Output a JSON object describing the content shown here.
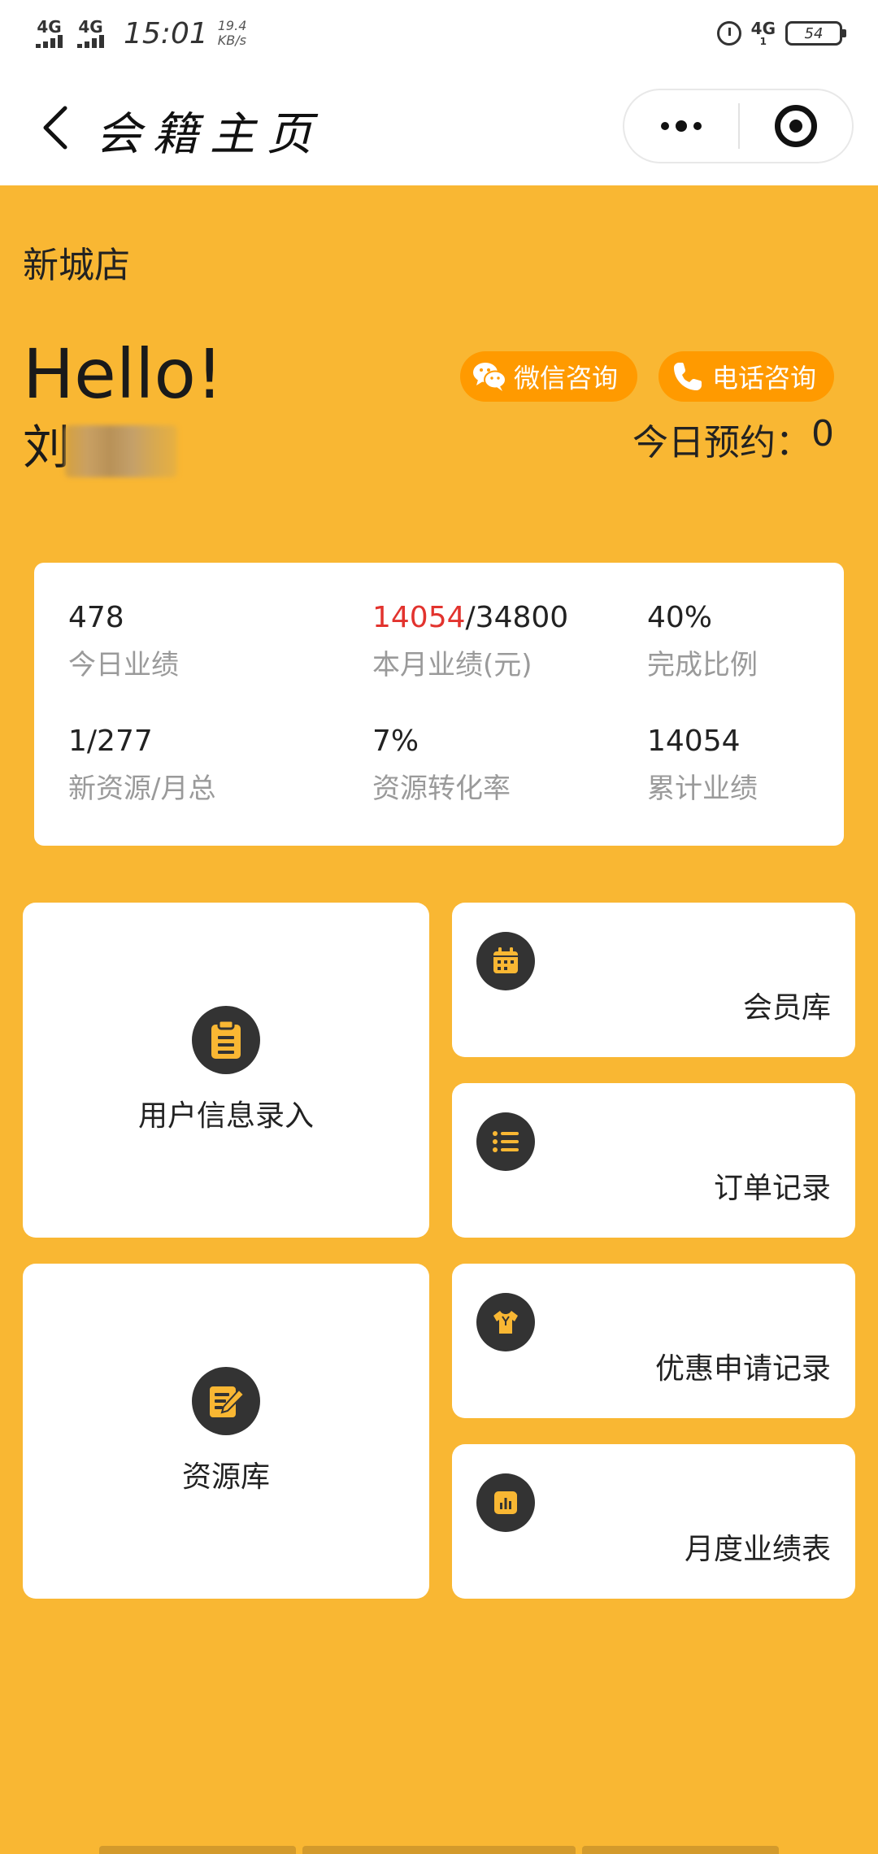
{
  "status_bar": {
    "signal_1": "4G",
    "signal_2": "4G",
    "time": "15:01",
    "speed_value": "19.4",
    "speed_unit": "KB/s",
    "network_right": "4G",
    "network_right_sub": "1",
    "battery": "54"
  },
  "nav": {
    "title": "会籍主页"
  },
  "header": {
    "store_name": "新城店",
    "greeting": "Hello!",
    "user_name": "刘",
    "wechat_button": "微信咨询",
    "phone_button": "电话咨询",
    "today_booking_label": "今日预约：",
    "today_booking_value": "0"
  },
  "stats": {
    "today_performance": {
      "value": "478",
      "label": "今日业绩"
    },
    "month_performance": {
      "value_current": "14054",
      "value_separator": "/",
      "value_target": "34800",
      "label": "本月业绩(元)"
    },
    "completion_ratio": {
      "value": "40%",
      "label": "完成比例"
    },
    "new_resources": {
      "value": "1/277",
      "label": "新资源/月总"
    },
    "conversion_rate": {
      "value": "7%",
      "label": "资源转化率"
    },
    "cumulative_performance": {
      "value": "14054",
      "label": "累计业绩"
    }
  },
  "tiles": {
    "user_info_entry": "用户信息录入",
    "member_library": "会员库",
    "order_records": "订单记录",
    "resource_library": "资源库",
    "discount_records": "优惠申请记录",
    "monthly_report": "月度业绩表"
  },
  "colors": {
    "background": "#F9B733",
    "accent": "#FF9A00",
    "highlight_red": "#E2332E",
    "icon_dark": "#333333"
  }
}
